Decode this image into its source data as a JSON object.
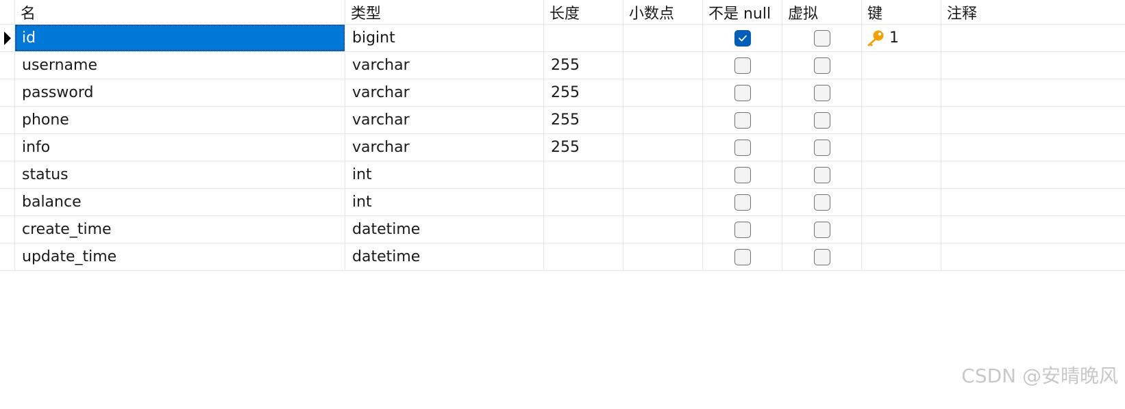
{
  "columns": {
    "name": "名",
    "type": "类型",
    "length": "长度",
    "decimals": "小数点",
    "not_null": "不是 null",
    "virtual": "虚拟",
    "key": "键",
    "comment": "注释"
  },
  "rows": [
    {
      "name": "id",
      "type": "bigint",
      "length": "",
      "decimals": "",
      "not_null": true,
      "virtual": false,
      "key": "1",
      "comment": "",
      "selected": true
    },
    {
      "name": "username",
      "type": "varchar",
      "length": "255",
      "decimals": "",
      "not_null": false,
      "virtual": false,
      "key": "",
      "comment": ""
    },
    {
      "name": "password",
      "type": "varchar",
      "length": "255",
      "decimals": "",
      "not_null": false,
      "virtual": false,
      "key": "",
      "comment": ""
    },
    {
      "name": "phone",
      "type": "varchar",
      "length": "255",
      "decimals": "",
      "not_null": false,
      "virtual": false,
      "key": "",
      "comment": ""
    },
    {
      "name": "info",
      "type": "varchar",
      "length": "255",
      "decimals": "",
      "not_null": false,
      "virtual": false,
      "key": "",
      "comment": ""
    },
    {
      "name": "status",
      "type": "int",
      "length": "",
      "decimals": "",
      "not_null": false,
      "virtual": false,
      "key": "",
      "comment": ""
    },
    {
      "name": "balance",
      "type": "int",
      "length": "",
      "decimals": "",
      "not_null": false,
      "virtual": false,
      "key": "",
      "comment": ""
    },
    {
      "name": "create_time",
      "type": "datetime",
      "length": "",
      "decimals": "",
      "not_null": false,
      "virtual": false,
      "key": "",
      "comment": ""
    },
    {
      "name": "update_time",
      "type": "datetime",
      "length": "",
      "decimals": "",
      "not_null": false,
      "virtual": false,
      "key": "",
      "comment": ""
    }
  ],
  "icons": {
    "primary_key": "key-icon",
    "row_pointer": "row-pointer-icon",
    "checkmark": "checkmark-icon"
  },
  "colors": {
    "selection": "#0078d7",
    "checkbox_checked": "#005fb8",
    "key_icon": "#f2a100"
  },
  "watermark": "CSDN @安晴晚风"
}
